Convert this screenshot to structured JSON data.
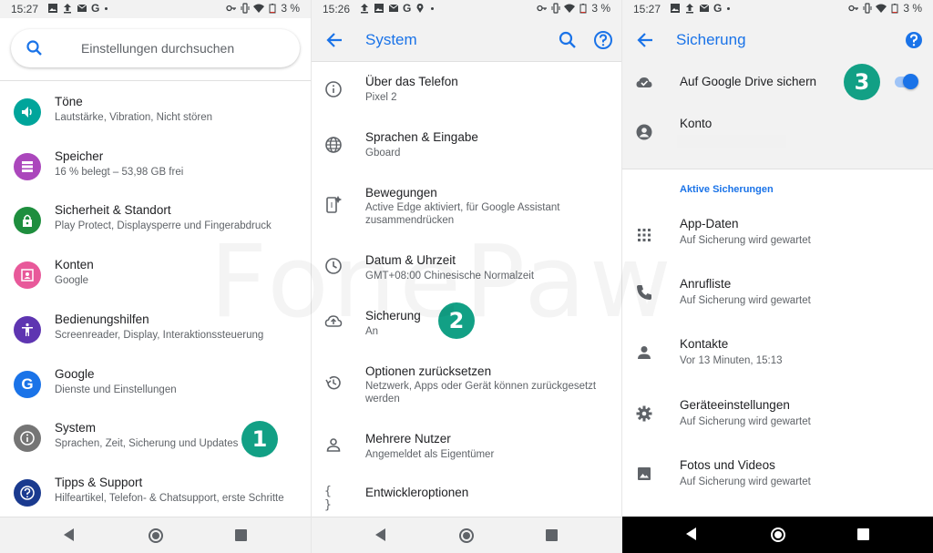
{
  "panels": [
    {
      "status": {
        "time": "15:27",
        "battery": "3 %"
      },
      "search": {
        "placeholder": "Einstellungen durchsuchen"
      },
      "items": [
        {
          "title": "Töne",
          "subtitle": "Lautstärke, Vibration, Nicht stören",
          "icon": "volume-icon",
          "color": "#00a59b"
        },
        {
          "title": "Speicher",
          "subtitle": "16 % belegt – 53,98 GB frei",
          "icon": "storage-icon",
          "color": "#ab47bc"
        },
        {
          "title": "Sicherheit & Standort",
          "subtitle": "Play Protect, Displaysperre und Fingerabdruck",
          "icon": "lock-icon",
          "color": "#1e8e3e"
        },
        {
          "title": "Konten",
          "subtitle": "Google",
          "icon": "account-box-icon",
          "color": "#e8599a"
        },
        {
          "title": "Bedienungshilfen",
          "subtitle": "Screenreader, Display, Interaktionssteuerung",
          "icon": "accessibility-icon",
          "color": "#5e35b1"
        },
        {
          "title": "Google",
          "subtitle": "Dienste und Einstellungen",
          "icon": "google-icon",
          "color": "#1a73e8"
        },
        {
          "title": "System",
          "subtitle": "Sprachen, Zeit, Sicherung und Updates",
          "icon": "info-icon",
          "color": "#757575"
        },
        {
          "title": "Tipps & Support",
          "subtitle": "Hilfeartikel, Telefon- & Chatsupport, erste Schritte",
          "icon": "help-icon",
          "color": "#1a3a8f"
        }
      ],
      "badge": "1"
    },
    {
      "status": {
        "time": "15:26",
        "battery": "3 %"
      },
      "title": "System",
      "rows": [
        {
          "title": "Über das Telefon",
          "subtitle": "Pixel 2",
          "icon": "info-outline-icon"
        },
        {
          "title": "Sprachen & Eingabe",
          "subtitle": "Gboard",
          "icon": "globe-icon"
        },
        {
          "title": "Bewegungen",
          "subtitle": "Active Edge aktiviert, für Google Assistant zusammendrücken",
          "icon": "gesture-phone-icon"
        },
        {
          "title": "Datum & Uhrzeit",
          "subtitle": "GMT+08:00 Chinesische Normalzeit",
          "icon": "clock-icon"
        },
        {
          "title": "Sicherung",
          "subtitle": "An",
          "icon": "cloud-upload-icon"
        },
        {
          "title": "Optionen zurücksetzen",
          "subtitle": "Netzwerk, Apps oder Gerät können zurückgesetzt werden",
          "icon": "history-icon"
        },
        {
          "title": "Mehrere Nutzer",
          "subtitle": "Angemeldet als Eigentümer",
          "icon": "person-outline-icon"
        },
        {
          "title": "Entwickleroptionen",
          "subtitle": "",
          "icon": "braces-icon"
        }
      ],
      "badge": "2"
    },
    {
      "status": {
        "time": "15:27",
        "battery": "3 %"
      },
      "title": "Sicherung",
      "backup_drive": "Auf Google Drive sichern",
      "account_label": "Konto",
      "section": "Aktive Sicherungen",
      "rows": [
        {
          "title": "App-Daten",
          "subtitle": "Auf Sicherung wird gewartet",
          "icon": "apps-grid-icon"
        },
        {
          "title": "Anrufliste",
          "subtitle": "Auf Sicherung wird gewartet",
          "icon": "phone-icon"
        },
        {
          "title": "Kontakte",
          "subtitle": "Vor 13 Minuten, 15:13",
          "icon": "person-icon"
        },
        {
          "title": "Geräteeinstellungen",
          "subtitle": "Auf Sicherung wird gewartet",
          "icon": "settings-gear-icon"
        },
        {
          "title": "Fotos und Videos",
          "subtitle": "Auf Sicherung wird gewartet",
          "icon": "image-icon"
        }
      ],
      "toggle_on": true,
      "badge": "3"
    }
  ],
  "watermark": "FonePaw",
  "colors": {
    "accent": "#1a73e8",
    "badge": "#12a085"
  }
}
